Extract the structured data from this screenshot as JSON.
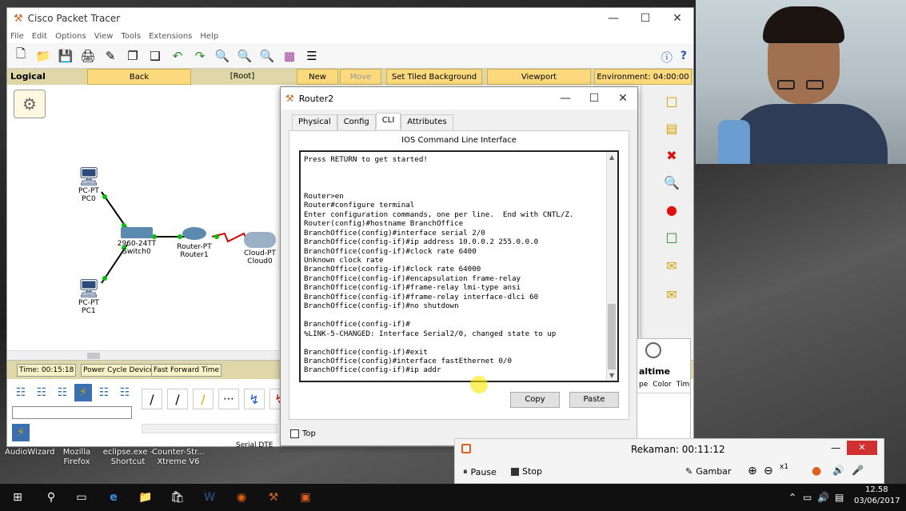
{
  "app": {
    "title": "Cisco Packet Tracer",
    "menu": [
      "File",
      "Edit",
      "Options",
      "View",
      "Tools",
      "Extensions",
      "Help"
    ],
    "navbar": {
      "logical": "Logical",
      "back": "Back",
      "root": "[Root]",
      "new_cluster": "New Cluster",
      "move_object": "Move Object",
      "set_tiled_background": "Set Tiled Background",
      "viewport": "Viewport",
      "environment": "Environment: 04:00:00"
    },
    "devices": {
      "pc0": {
        "type": "PC-PT",
        "name": "PC0"
      },
      "pc1": {
        "type": "PC-PT",
        "name": "PC1"
      },
      "switch0": {
        "type": "2960-24TT",
        "name": "Switch0"
      },
      "router1": {
        "type": "Router-PT",
        "name": "Router1"
      },
      "cloud0": {
        "type": "Cloud-PT",
        "name": "Cloud0"
      }
    },
    "status": {
      "time": "Time: 00:15:18",
      "power_cycle": "Power Cycle Devices",
      "fast_forward": "Fast Forward Time",
      "realtime": "altime"
    },
    "bottom": {
      "serial_dte": "Serial DTE",
      "pdu_headers": [
        "pe",
        "Color",
        "Tim"
      ]
    }
  },
  "router2": {
    "title": "Router2",
    "tabs": [
      "Physical",
      "Config",
      "CLI",
      "Attributes"
    ],
    "active_tab": "CLI",
    "section_title": "IOS Command Line Interface",
    "cli_lines": [
      "Press RETURN to get started!",
      "",
      "",
      "",
      "Router>en",
      "Router#configure terminal",
      "Enter configuration commands, one per line.  End with CNTL/Z.",
      "Router(config)#hostname BranchOffice",
      "BranchOffice(config)#interface serial 2/0",
      "BranchOffice(config-if)#ip address 10.0.0.2 255.0.0.0",
      "BranchOffice(config-if)#clock rate 6400",
      "Unknown clock rate",
      "BranchOffice(config-if)#clock rate 64000",
      "BranchOffice(config-if)#encapsulation frame-relay",
      "BranchOffice(config-if)#frame-relay lmi-type ansi",
      "BranchOffice(config-if)#frame-relay interface-dlci 60",
      "BranchOffice(config-if)#no shutdown",
      "",
      "BranchOffice(config-if)#",
      "%LINK-5-CHANGED: Interface Serial2/0, changed state to up",
      "",
      "BranchOffice(config-if)#exit",
      "BranchOffice(config)#interface fastEthernet 0/0",
      "BranchOffice(config-if)#ip addr"
    ],
    "copy_label": "Copy",
    "paste_label": "Paste",
    "top_label": "Top"
  },
  "recorder": {
    "title": "Rekaman: 00:11:12",
    "pause": "Pause",
    "stop": "Stop",
    "gambar": "Gambar",
    "zoom": "x1"
  },
  "desktop_icons": [
    {
      "label1": "AudioWizard",
      "label2": ""
    },
    {
      "label1": "Mozilla",
      "label2": "Firefox"
    },
    {
      "label1": "eclipse.exe -",
      "label2": "Shortcut"
    },
    {
      "label1": "Counter-Str...",
      "label2": "Xtreme V6"
    }
  ],
  "taskbar": {
    "time": "12.58",
    "date": "03/06/2017"
  },
  "colors": {
    "navbar_bg": "#e0d7a9",
    "nav_button": "#fcd97c",
    "link_green": "#00c000",
    "serial_red": "#d00000",
    "taskbar": "#101010"
  }
}
